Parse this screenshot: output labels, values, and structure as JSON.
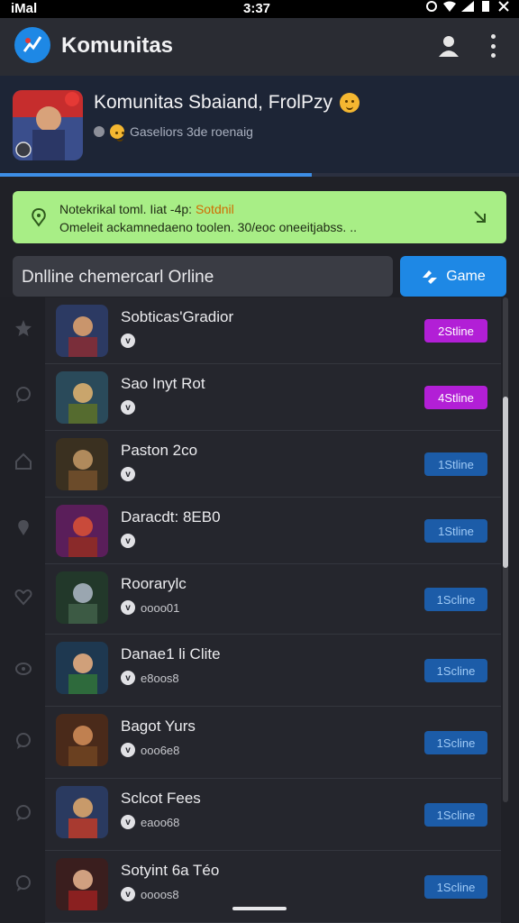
{
  "status_bar": {
    "left": "iMal",
    "time": "3:37"
  },
  "app_bar": {
    "title": "Komunitas"
  },
  "header": {
    "title": "Komunitas Sbaiand, FrolPzy",
    "subtitle": "Gaseliors 3de roenaig",
    "progress": 0.6
  },
  "notice": {
    "line1_prefix": "Notekrikal toml. Iiat -4p: ",
    "line1_highlight": "Sotdnil",
    "line2": "Omeleit ackamnedaeno toolen. 30/eoc oneeitjabss. .."
  },
  "search": {
    "value": "Dnlline chemercarl Orline"
  },
  "game_button": {
    "label": "Game"
  },
  "rows": [
    {
      "title": "Sobticas'Gradior",
      "meta": "",
      "badge": "2Stline",
      "badge_color": "#b21fd6"
    },
    {
      "title": "Sao Inyt Rot",
      "meta": "",
      "badge": "4Stline",
      "badge_color": "#b21fd6"
    },
    {
      "title": "Paston 2co",
      "meta": "",
      "badge": "1Stline",
      "badge_color": "#1c5ca8"
    },
    {
      "title": "Daracdt: 8EB0",
      "meta": "",
      "badge": "1Stline",
      "badge_color": "#1c5ca8"
    },
    {
      "title": "Roorarylc",
      "meta": "oooo01",
      "badge": "1Scline",
      "badge_color": "#1c5ca8"
    },
    {
      "title": "Danae1 li Clite",
      "meta": "e8oos8",
      "badge": "1Scline",
      "badge_color": "#1c5ca8"
    },
    {
      "title": "Bagot Yurs",
      "meta": "ooo6e8",
      "badge": "1Scline",
      "badge_color": "#1c5ca8"
    },
    {
      "title": "Sclcot Fees",
      "meta": "eaoo68",
      "badge": "1Scline",
      "badge_color": "#1c5ca8"
    },
    {
      "title": "Sotyint 6a Téo",
      "meta": "oooos8",
      "badge": "1Scline",
      "badge_color": "#1c5ca8"
    }
  ],
  "colors": {
    "accent": "#1e88e5",
    "notice_bg": "#a8ee86",
    "badge_purple": "#b21fd6",
    "badge_blue": "#1c5ca8"
  }
}
